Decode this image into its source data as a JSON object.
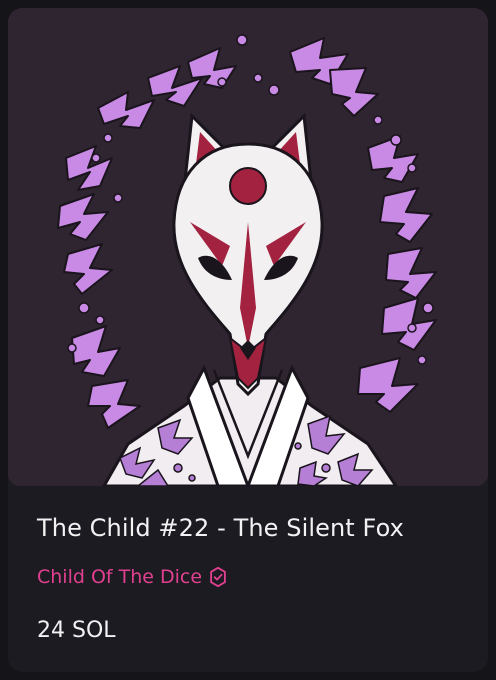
{
  "nft": {
    "title": "The Child #22 - The Silent Fox",
    "collection": "Child Of The Dice",
    "price": "24 SOL"
  },
  "colors": {
    "background": "#151419",
    "card": "#1c1b21",
    "art_background": "#2f2530",
    "accent": "#e0408f",
    "purple_glyphs": "#c98ae6",
    "mask_red": "#a3223f",
    "text": "#f2f2f4"
  },
  "icons": {
    "verified": "verified-badge-icon"
  }
}
